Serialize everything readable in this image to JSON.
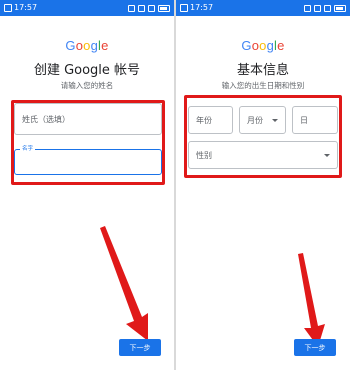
{
  "status": {
    "time": "17:57"
  },
  "logo": {
    "letters": [
      "G",
      "o",
      "o",
      "g",
      "l",
      "e"
    ],
    "colors": [
      "#4285F4",
      "#EA4335",
      "#FBBC05",
      "#4285F4",
      "#34A853",
      "#EA4335"
    ]
  },
  "left": {
    "title": "创建 Google 帐号",
    "subtitle": "请输入您的姓名",
    "lastname_placeholder": "姓氏（选填）",
    "firstname_label": "名字",
    "next_label": "下一步"
  },
  "right": {
    "title": "基本信息",
    "subtitle": "输入您的出生日期和性别",
    "year_placeholder": "年份",
    "month_placeholder": "月份",
    "day_placeholder": "日",
    "gender_placeholder": "性别",
    "next_label": "下一步"
  },
  "colors": {
    "primary": "#1a73e8",
    "highlight": "#e01919"
  }
}
